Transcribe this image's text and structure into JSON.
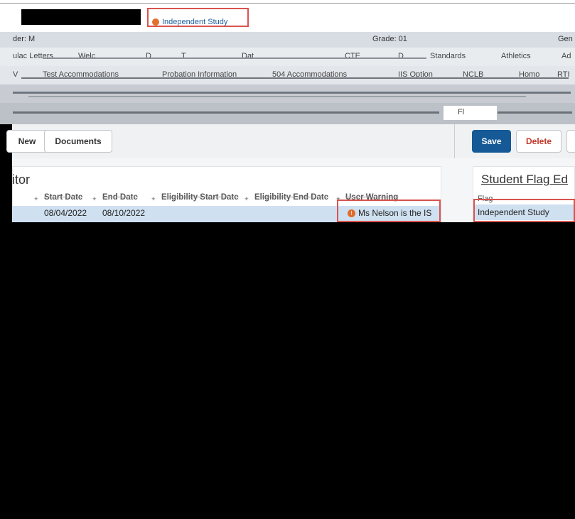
{
  "header": {
    "tab_label": "Independent Study",
    "student_row": {
      "left_text": "der: M",
      "grade_text": "Grade: 01",
      "right_text": "Gen"
    }
  },
  "nav": {
    "row1": [
      "ulac Letters",
      "Welc",
      "D",
      "T",
      "Dat",
      "CTE",
      "D",
      "Standards",
      "Athletics",
      "Ad"
    ],
    "row2": [
      "V",
      "Test Accommodations",
      "Probation Information",
      "504 Accommodations",
      "IIS Option",
      "NCLB",
      "Homo",
      "RTI"
    ],
    "row4_flag_text": "Fl"
  },
  "toolbar": {
    "new_label": "New",
    "documents_label": "Documents",
    "save_label": "Save",
    "delete_label": "Delete"
  },
  "left_panel": {
    "title": "itor",
    "columns": [
      "Start Date",
      "End Date",
      "Eligibility Start Date",
      "Eligibility End Date",
      "User Warning"
    ],
    "rows": [
      {
        "start_date": "08/04/2022",
        "end_date": "08/10/2022",
        "elig_start": "",
        "elig_end": "",
        "warning": "Ms Nelson is the IS"
      }
    ]
  },
  "right_panel": {
    "title": "Student Flag Ed",
    "flag_label": "Flag",
    "flag_value": "Independent Study"
  },
  "colors": {
    "primary": "#155a96",
    "danger": "#c0392b",
    "selected_row": "#cfe0f0",
    "highlight_border": "#d9534f",
    "warning_icon": "#e06c2c"
  }
}
